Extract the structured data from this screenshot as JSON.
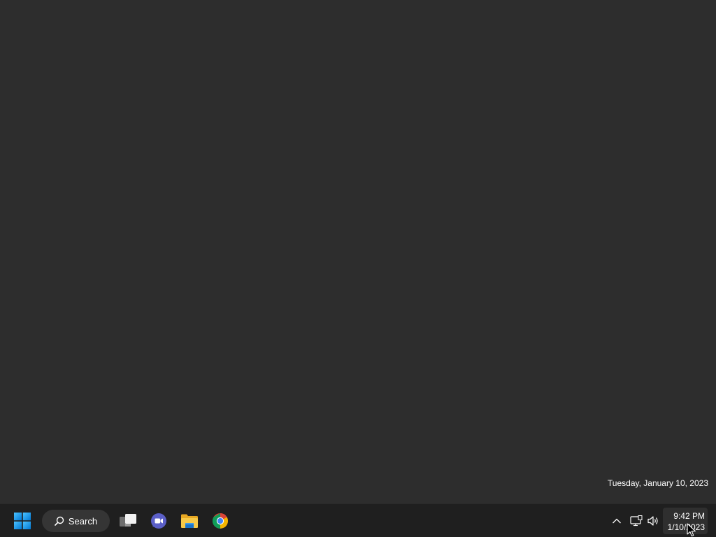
{
  "desktop": {
    "background_color": "#2d2d2d",
    "date_tooltip": "Tuesday, January 10, 2023"
  },
  "taskbar": {
    "background_color": "#1f1f1f",
    "start_icon": "windows-logo-icon",
    "search_label": "Search",
    "pinned_apps": [
      {
        "name": "Task View",
        "icon": "task-view-icon"
      },
      {
        "name": "Teams Chat",
        "icon": "teams-icon"
      },
      {
        "name": "File Explorer",
        "icon": "folder-icon"
      },
      {
        "name": "Google Chrome",
        "icon": "chrome-icon"
      }
    ],
    "tray": {
      "chevron_icon": "chevron-up-icon",
      "network_icon": "network-icon",
      "volume_icon": "volume-icon"
    },
    "clock": {
      "time": "9:42 PM",
      "date": "1/10/2023"
    }
  },
  "colors": {
    "accent": "#0078d4",
    "folder": "#f5c242",
    "teams": "#5b5fc7"
  }
}
